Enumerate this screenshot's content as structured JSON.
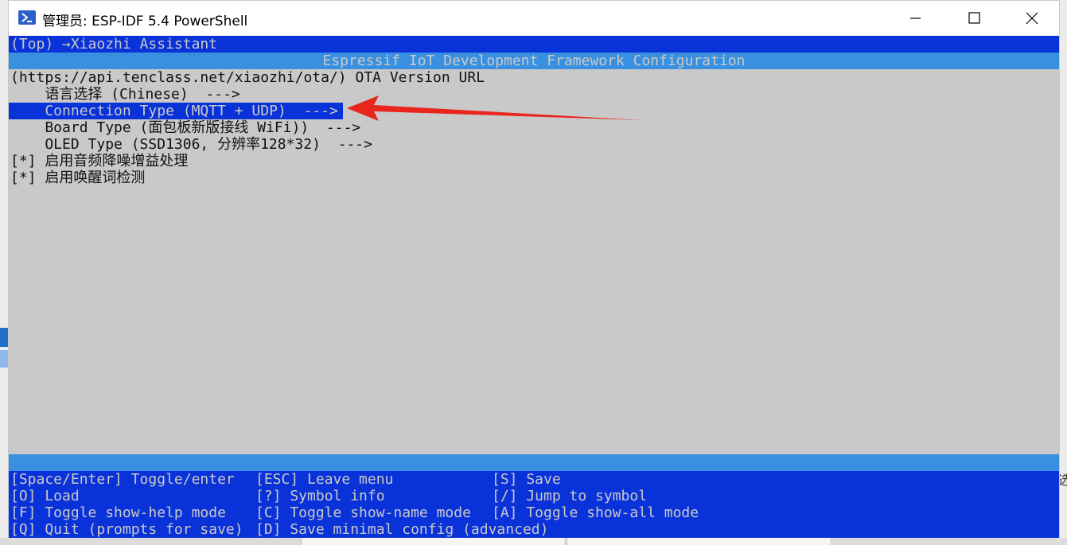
{
  "window": {
    "title": "管理员: ESP-IDF 5.4 PowerShell",
    "icon": "powershell-icon"
  },
  "terminal": {
    "breadcrumb": "(Top) →Xiaozhi Assistant",
    "banner": "Espressif IoT Development Framework Configuration",
    "menu": [
      {
        "text": "(https://api.tenclass.net/xiaozhi/ota/) OTA Version URL",
        "selected": false
      },
      {
        "text": "    语言选择 (Chinese)  --->",
        "selected": false
      },
      {
        "text": "    Connection Type (MQTT + UDP)  --->",
        "selected": true
      },
      {
        "text": "    Board Type (面包板新版接线 WiFi))  --->",
        "selected": false
      },
      {
        "text": "    OLED Type (SSD1306, 分辨率128*32)  --->",
        "selected": false
      },
      {
        "text": "[*] 启用音频降噪增益处理",
        "selected": false
      },
      {
        "text": "[*] 启用唤醒词检测",
        "selected": false
      }
    ],
    "help": [
      [
        "[Space/Enter] Toggle/enter",
        "[ESC] Leave menu",
        "[S] Save"
      ],
      [
        "[O] Load",
        "[?] Symbol info",
        "[/] Jump to symbol"
      ],
      [
        "[F] Toggle show-help mode",
        "[C] Toggle show-name mode",
        "[A] Toggle show-all mode"
      ],
      [
        "[Q] Quit (prompts for save)",
        "[D] Save minimal config (advanced)",
        ""
      ]
    ]
  },
  "colors": {
    "terminal_bg": "#c9c9c9",
    "highlight": "#0a32d9",
    "banner": "#3a90e0",
    "annotation_arrow": "#e8261e"
  },
  "side_glyph": "选"
}
